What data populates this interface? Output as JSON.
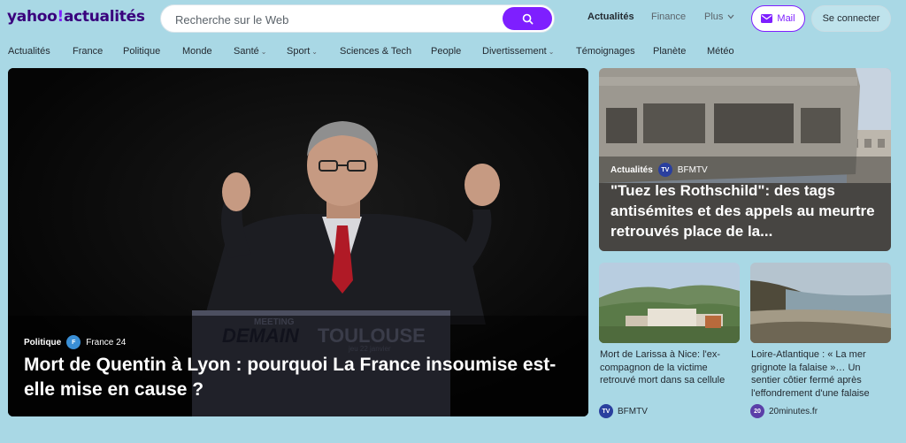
{
  "logo": {
    "brand": "yahoo",
    "slash": "!",
    "section": "actualités"
  },
  "search": {
    "placeholder": "Recherche sur le Web"
  },
  "topnav": [
    {
      "label": "Actualités",
      "active": true
    },
    {
      "label": "Finance",
      "active": false
    },
    {
      "label": "Plus",
      "active": false
    }
  ],
  "account": {
    "mail_label": "Mail",
    "login_label": "Se connecter"
  },
  "categories": [
    {
      "label": "Actualités",
      "dropdown": false
    },
    {
      "label": "France",
      "dropdown": false
    },
    {
      "label": "Politique",
      "dropdown": false
    },
    {
      "label": "Monde",
      "dropdown": false
    },
    {
      "label": "Santé",
      "dropdown": true
    },
    {
      "label": "Sport",
      "dropdown": true
    },
    {
      "label": "Sciences & Tech",
      "dropdown": false
    },
    {
      "label": "People",
      "dropdown": false
    },
    {
      "label": "Divertissement",
      "dropdown": true
    },
    {
      "label": "Témoignages",
      "dropdown": false
    },
    {
      "label": "Planète",
      "dropdown": false
    },
    {
      "label": "Météo",
      "dropdown": false
    }
  ],
  "hero": {
    "category": "Politique",
    "source": "France 24",
    "title": "Mort de Quentin à Lyon : pourquoi La France insoumise est-elle mise en cause ?",
    "podium_small": "MEETING",
    "podium_big_1": "DEMAIN",
    "podium_big_2": "TOULOUSE",
    "podium_date": "jeu 22 janvier"
  },
  "top_card": {
    "category": "Actualités",
    "source": "BFMTV",
    "title": "\"Tuez les Rothschild\": des tags antisémites et des appels au meurtre retrouvés place de la..."
  },
  "small_cards": [
    {
      "title": "Mort de Larissa à Nice: l'ex-compagnon de la victime retrouvé mort dans sa cellule",
      "source": "BFMTV"
    },
    {
      "title": "Loire-Atlantique : « La mer grignote la falaise »… Un sentier côtier fermé après l'effondrement d'une falaise",
      "source": "20minutes.fr"
    }
  ],
  "colors": {
    "brand": "#7e1fff",
    "brand_dark": "#39007d",
    "page_bg": "#a9d8e5",
    "bfmtv": "#2a3f9e",
    "france24": "#3a8fd6",
    "minutes20": "#5b3fa8"
  },
  "icons": {
    "search": "search-icon",
    "mail": "mail-icon",
    "chevron": "chevron-down-icon"
  }
}
